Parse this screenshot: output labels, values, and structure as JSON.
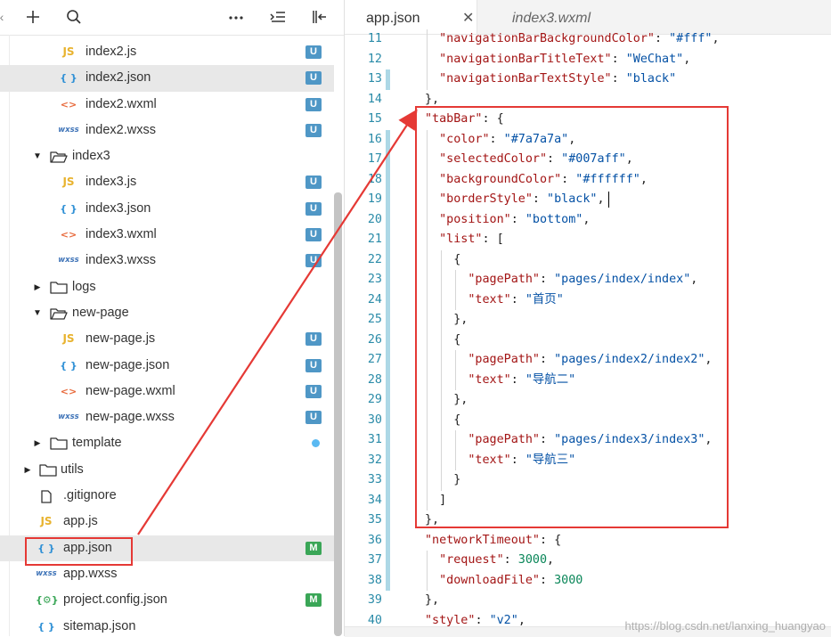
{
  "toolbar": {
    "left_glyph": "‹",
    "add_icon": "plus-icon",
    "search_icon": "search-icon",
    "more_icon": "more-icon",
    "collapse_icon": "collapse-icon",
    "split_icon": "split-icon"
  },
  "tree": [
    {
      "name": "index2.js",
      "type": "js",
      "icon_text": "JS",
      "level": 2,
      "badge": "U"
    },
    {
      "name": "index2.json",
      "type": "json",
      "icon_text": "{ }",
      "level": 2,
      "badge": "U",
      "selected": true
    },
    {
      "name": "index2.wxml",
      "type": "wxml",
      "icon_text": "<>",
      "level": 2,
      "badge": "U"
    },
    {
      "name": "index2.wxss",
      "type": "wxss",
      "icon_text": "wxss",
      "level": 2,
      "badge": "U"
    },
    {
      "name": "index3",
      "type": "folder",
      "open": true,
      "level": 1
    },
    {
      "name": "index3.js",
      "type": "js",
      "icon_text": "JS",
      "level": 2,
      "badge": "U"
    },
    {
      "name": "index3.json",
      "type": "json",
      "icon_text": "{ }",
      "level": 2,
      "badge": "U"
    },
    {
      "name": "index3.wxml",
      "type": "wxml",
      "icon_text": "<>",
      "level": 2,
      "badge": "U"
    },
    {
      "name": "index3.wxss",
      "type": "wxss",
      "icon_text": "wxss",
      "level": 2,
      "badge": "U"
    },
    {
      "name": "logs",
      "type": "folder",
      "open": false,
      "level": 1
    },
    {
      "name": "new-page",
      "type": "folder",
      "open": true,
      "level": 1
    },
    {
      "name": "new-page.js",
      "type": "js",
      "icon_text": "JS",
      "level": 2,
      "badge": "U"
    },
    {
      "name": "new-page.json",
      "type": "json",
      "icon_text": "{ }",
      "level": 2,
      "badge": "U"
    },
    {
      "name": "new-page.wxml",
      "type": "wxml",
      "icon_text": "<>",
      "level": 2,
      "badge": "U"
    },
    {
      "name": "new-page.wxss",
      "type": "wxss",
      "icon_text": "wxss",
      "level": 2,
      "badge": "U"
    },
    {
      "name": "template",
      "type": "folder",
      "open": false,
      "level": 1,
      "dot": true
    },
    {
      "name": "utils",
      "type": "folder",
      "open": false,
      "level": 0
    },
    {
      "name": ".gitignore",
      "type": "file",
      "icon_text": "",
      "level": 0
    },
    {
      "name": "app.js",
      "type": "js",
      "icon_text": "JS",
      "level": 0
    },
    {
      "name": "app.json",
      "type": "json",
      "icon_text": "{ }",
      "level": 0,
      "badge": "M",
      "selected": true
    },
    {
      "name": "app.wxss",
      "type": "wxss",
      "icon_text": "wxss",
      "level": 0
    },
    {
      "name": "project.config.json",
      "type": "config",
      "icon_text": "{⚙}",
      "level": 0,
      "badge": "M"
    },
    {
      "name": "sitemap.json",
      "type": "json",
      "icon_text": "{ }",
      "level": 0
    }
  ],
  "tabs": [
    {
      "label": "app.json",
      "active": true,
      "close_glyph": "✕"
    },
    {
      "label": "index3.wxml",
      "active": false
    }
  ],
  "code": [
    {
      "n": 11,
      "indent": 1,
      "tokens": [
        [
          "k",
          "\"navigationBarBackgroundColor\""
        ],
        [
          "p",
          ": "
        ],
        [
          "s",
          "\"#fff\""
        ],
        [
          "p",
          ","
        ]
      ]
    },
    {
      "n": 12,
      "indent": 1,
      "tokens": [
        [
          "k",
          "\"navigationBarTitleText\""
        ],
        [
          "p",
          ": "
        ],
        [
          "s",
          "\"WeChat\""
        ],
        [
          "p",
          ","
        ]
      ]
    },
    {
      "n": 13,
      "indent": 1,
      "tokens": [
        [
          "k",
          "\"navigationBarTextStyle\""
        ],
        [
          "p",
          ": "
        ],
        [
          "s",
          "\"black\""
        ]
      ]
    },
    {
      "n": 14,
      "indent": 0,
      "tokens": [
        [
          "p",
          "},"
        ]
      ]
    },
    {
      "n": 15,
      "indent": 0,
      "tokens": [
        [
          "k",
          "\"tabBar\""
        ],
        [
          "p",
          ": {"
        ]
      ]
    },
    {
      "n": 16,
      "indent": 1,
      "tokens": [
        [
          "k",
          "\"color\""
        ],
        [
          "p",
          ": "
        ],
        [
          "s",
          "\"#7a7a7a\""
        ],
        [
          "p",
          ","
        ]
      ]
    },
    {
      "n": 17,
      "indent": 1,
      "tokens": [
        [
          "k",
          "\"selectedColor\""
        ],
        [
          "p",
          ": "
        ],
        [
          "s",
          "\"#007aff\""
        ],
        [
          "p",
          ","
        ]
      ]
    },
    {
      "n": 18,
      "indent": 1,
      "tokens": [
        [
          "k",
          "\"backgroundColor\""
        ],
        [
          "p",
          ": "
        ],
        [
          "s",
          "\"#ffffff\""
        ],
        [
          "p",
          ","
        ]
      ]
    },
    {
      "n": 19,
      "indent": 1,
      "tokens": [
        [
          "k",
          "\"borderStyle\""
        ],
        [
          "p",
          ": "
        ],
        [
          "s",
          "\"black\""
        ],
        [
          "p",
          ","
        ]
      ]
    },
    {
      "n": 20,
      "indent": 1,
      "tokens": [
        [
          "k",
          "\"position\""
        ],
        [
          "p",
          ": "
        ],
        [
          "s",
          "\"bottom\""
        ],
        [
          "p",
          ","
        ]
      ]
    },
    {
      "n": 21,
      "indent": 1,
      "tokens": [
        [
          "k",
          "\"list\""
        ],
        [
          "p",
          ": ["
        ]
      ]
    },
    {
      "n": 22,
      "indent": 2,
      "tokens": [
        [
          "p",
          "{"
        ]
      ]
    },
    {
      "n": 23,
      "indent": 3,
      "tokens": [
        [
          "k",
          "\"pagePath\""
        ],
        [
          "p",
          ": "
        ],
        [
          "s",
          "\"pages/index/index\""
        ],
        [
          "p",
          ","
        ]
      ]
    },
    {
      "n": 24,
      "indent": 3,
      "tokens": [
        [
          "k",
          "\"text\""
        ],
        [
          "p",
          ": "
        ],
        [
          "s",
          "\"首页\""
        ]
      ]
    },
    {
      "n": 25,
      "indent": 2,
      "tokens": [
        [
          "p",
          "},"
        ]
      ]
    },
    {
      "n": 26,
      "indent": 2,
      "tokens": [
        [
          "p",
          "{"
        ]
      ]
    },
    {
      "n": 27,
      "indent": 3,
      "tokens": [
        [
          "k",
          "\"pagePath\""
        ],
        [
          "p",
          ": "
        ],
        [
          "s",
          "\"pages/index2/index2\""
        ],
        [
          "p",
          ","
        ]
      ]
    },
    {
      "n": 28,
      "indent": 3,
      "tokens": [
        [
          "k",
          "\"text\""
        ],
        [
          "p",
          ": "
        ],
        [
          "s",
          "\"导航二\""
        ]
      ]
    },
    {
      "n": 29,
      "indent": 2,
      "tokens": [
        [
          "p",
          "},"
        ]
      ]
    },
    {
      "n": 30,
      "indent": 2,
      "tokens": [
        [
          "p",
          "{"
        ]
      ]
    },
    {
      "n": 31,
      "indent": 3,
      "tokens": [
        [
          "k",
          "\"pagePath\""
        ],
        [
          "p",
          ": "
        ],
        [
          "s",
          "\"pages/index3/index3\""
        ],
        [
          "p",
          ","
        ]
      ]
    },
    {
      "n": 32,
      "indent": 3,
      "tokens": [
        [
          "k",
          "\"text\""
        ],
        [
          "p",
          ": "
        ],
        [
          "s",
          "\"导航三\""
        ]
      ]
    },
    {
      "n": 33,
      "indent": 2,
      "tokens": [
        [
          "p",
          "}"
        ]
      ]
    },
    {
      "n": 34,
      "indent": 1,
      "tokens": [
        [
          "p",
          "]"
        ]
      ]
    },
    {
      "n": 35,
      "indent": 0,
      "tokens": [
        [
          "p",
          "},"
        ]
      ]
    },
    {
      "n": 36,
      "indent": 0,
      "tokens": [
        [
          "k",
          "\"networkTimeout\""
        ],
        [
          "p",
          ": {"
        ]
      ]
    },
    {
      "n": 37,
      "indent": 1,
      "tokens": [
        [
          "k",
          "\"request\""
        ],
        [
          "p",
          ": "
        ],
        [
          "n",
          "3000"
        ],
        [
          "p",
          ","
        ]
      ]
    },
    {
      "n": 38,
      "indent": 1,
      "tokens": [
        [
          "k",
          "\"downloadFile\""
        ],
        [
          "p",
          ": "
        ],
        [
          "n",
          "3000"
        ]
      ]
    },
    {
      "n": 39,
      "indent": 0,
      "tokens": [
        [
          "p",
          "},"
        ]
      ]
    },
    {
      "n": 40,
      "indent": 0,
      "tokens": [
        [
          "k",
          "\"style\""
        ],
        [
          "p",
          ": "
        ],
        [
          "s",
          "\"v2\""
        ],
        [
          "p",
          ","
        ]
      ]
    }
  ],
  "colors": {
    "badge_u": "#4f97c6",
    "badge_m": "#3aa657",
    "dot": "#5ab9f2",
    "js_icon": "#e8b22d",
    "json_icon": "#2d8fd5",
    "wxml_icon": "#e86a3c",
    "wxss_icon": "#3f74b8",
    "config_icon": "#3aa657",
    "annotation_red": "#e53935"
  },
  "watermark": "https://blog.csdn.net/lanxing_huangyao",
  "footer_glyph": "ᐩ"
}
